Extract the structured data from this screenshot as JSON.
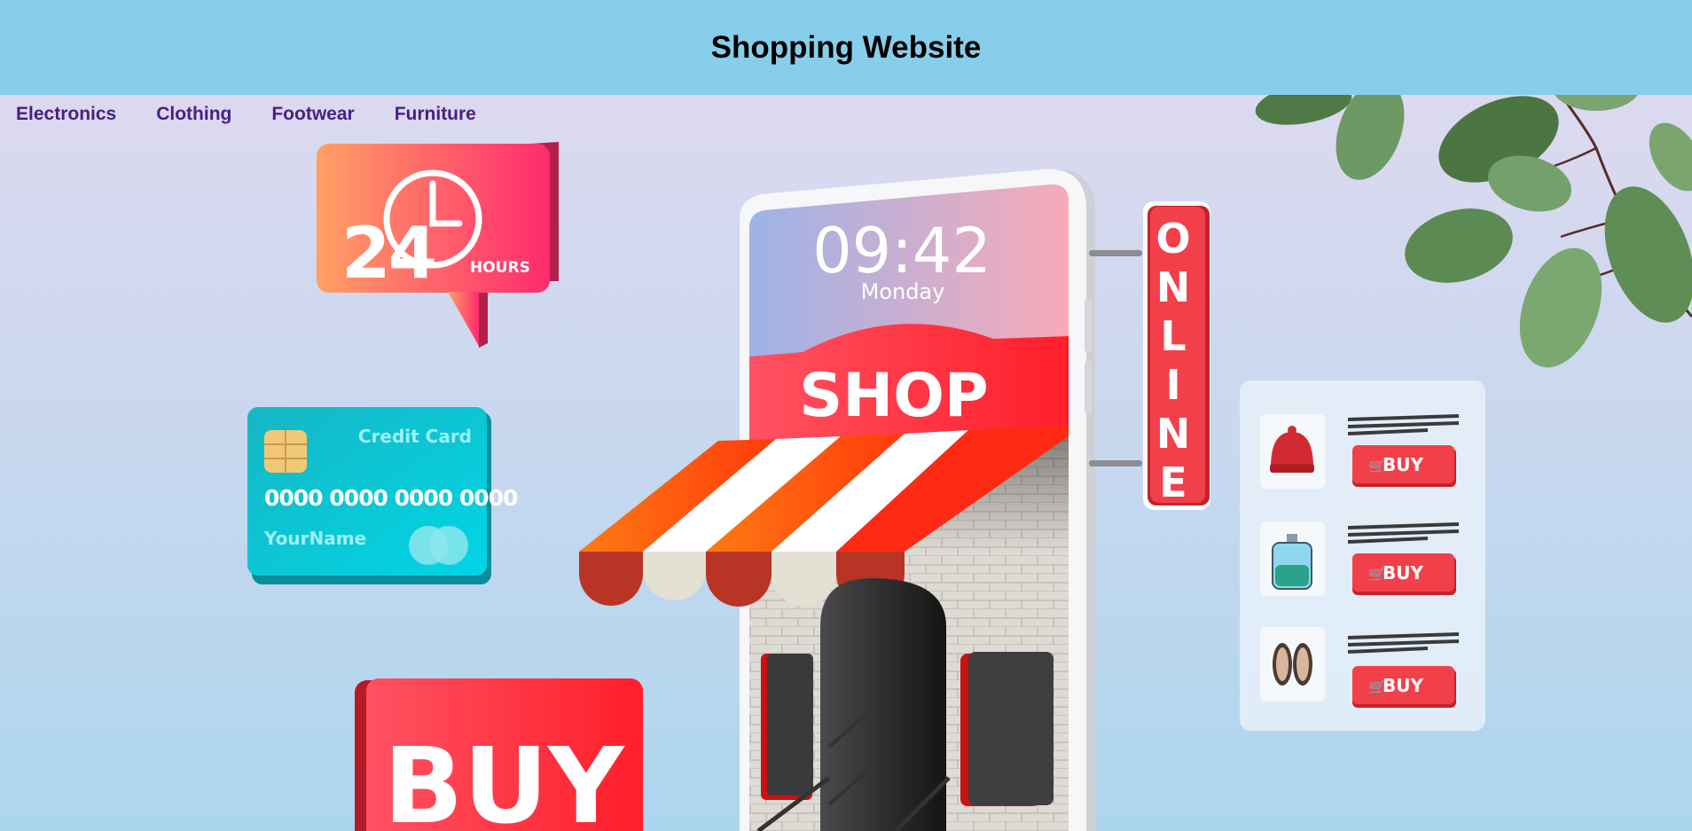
{
  "header": {
    "title": "Shopping Website"
  },
  "nav": {
    "items": [
      {
        "label": "Electronics"
      },
      {
        "label": "Clothing"
      },
      {
        "label": "Footwear"
      },
      {
        "label": "Furniture"
      }
    ]
  },
  "banner": {
    "hours_badge": {
      "number": "24",
      "unit": "HOURS"
    },
    "credit_card": {
      "label": "Credit Card",
      "number": "0000 0000 0000 0000",
      "holder": "YourName"
    },
    "phone": {
      "time": "09:42",
      "day": "Monday",
      "shop_sign": "SHOP"
    },
    "vertical_sign": "ONLINE",
    "buy_sign": "BUY",
    "product_panel": {
      "items": [
        {
          "icon": "beanie-hat-icon",
          "button": "BUY"
        },
        {
          "icon": "perfume-bottle-icon",
          "button": "BUY"
        },
        {
          "icon": "sandals-icon",
          "button": "BUY"
        }
      ]
    }
  },
  "colors": {
    "header_bg": "#87ceeb",
    "nav_link": "#4b1d85",
    "accent_red": "#f2404a",
    "card_teal": "#12c3cf"
  }
}
